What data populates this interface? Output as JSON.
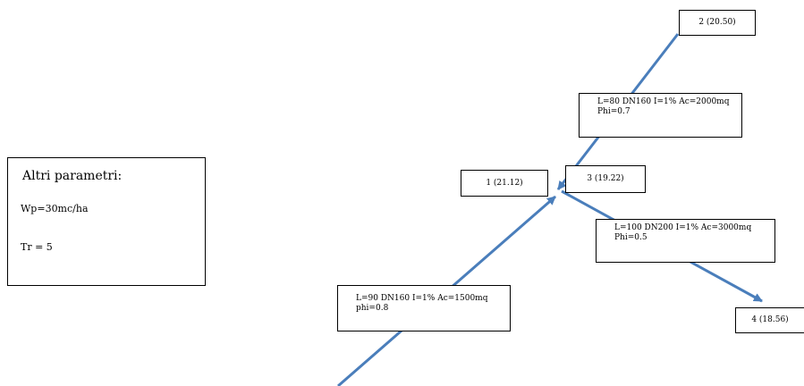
{
  "params": {
    "title": "Altri parametri:",
    "wp": "Wp=30mc/ha",
    "tr": "Tr = 5"
  },
  "nodes": {
    "n1": "1 (21.12)",
    "n2": "2 (20.50)",
    "n3": "3 (19.22)",
    "n4": "4 (18.56)"
  },
  "pipes": {
    "p23": {
      "line1": "L=80 DN160 I=1% Ac=2000mq",
      "line2": "Phi=0.7"
    },
    "p34": {
      "line1": "L=100 DN200 I=1%  Ac=3000mq",
      "line2": "Phi=0.5"
    },
    "p13": {
      "line1": "L=90 DN160 I=1%  Ac=1500mq",
      "line2": "phi=0.8"
    }
  },
  "colors": {
    "pipe_line": "#4a7ebb",
    "box_border": "#000000"
  }
}
